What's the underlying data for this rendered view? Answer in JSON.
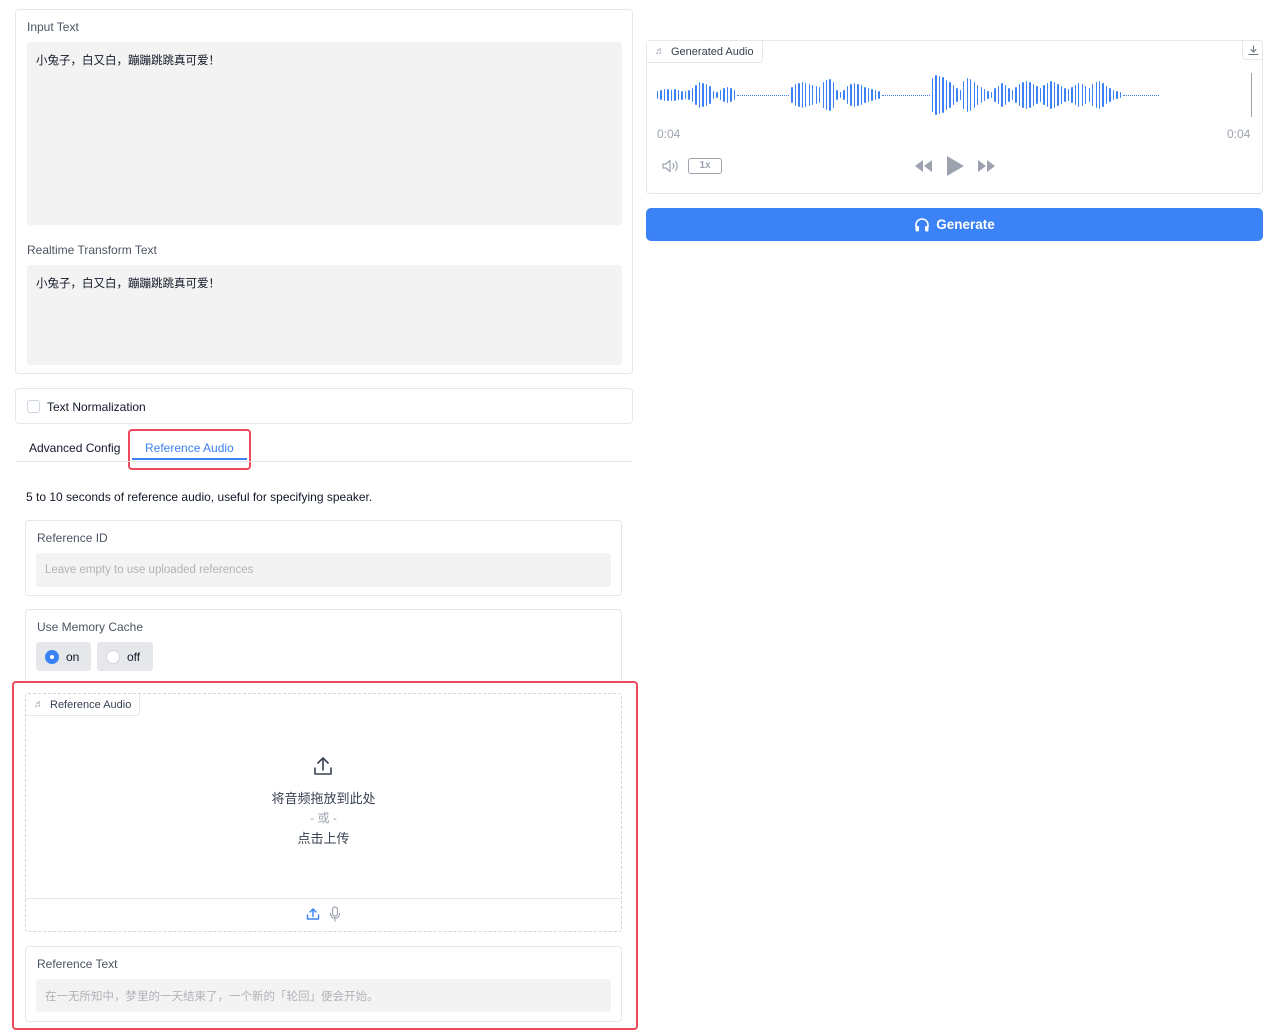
{
  "input_text": {
    "label": "Input Text",
    "value": "小兔子，白又白，蹦蹦跳跳真可爱！"
  },
  "transform_text": {
    "label": "Realtime Transform Text",
    "value": "小兔子，白又白，蹦蹦跳跳真可爱！"
  },
  "normalization": {
    "label": "Text Normalization",
    "checked": false
  },
  "tabs": [
    {
      "label": "Advanced Config",
      "active": false
    },
    {
      "label": "Reference Audio",
      "active": true
    }
  ],
  "reference_tab": {
    "description": "5 to 10 seconds of reference audio, useful for specifying speaker.",
    "reference_id": {
      "label": "Reference ID",
      "placeholder": "Leave empty to use uploaded references"
    },
    "memory_cache": {
      "label": "Use Memory Cache",
      "options": [
        "on",
        "off"
      ],
      "selected": "on"
    },
    "reference_audio": {
      "label": "Reference Audio",
      "drop_text": "将音频拖放到此处",
      "or_text": "- 或 -",
      "click_text": "点击上传"
    },
    "reference_text": {
      "label": "Reference Text",
      "placeholder": "在一无所知中，梦里的一天结束了，一个新的「轮回」便会开始。"
    }
  },
  "generated_audio": {
    "label": "Generated Audio",
    "current_time": "0:04",
    "duration": "0:04",
    "speed": "1x"
  },
  "generate_button": {
    "label": "Generate"
  },
  "colors": {
    "accent": "#3b82f6",
    "highlight": "#ef4a5b"
  }
}
